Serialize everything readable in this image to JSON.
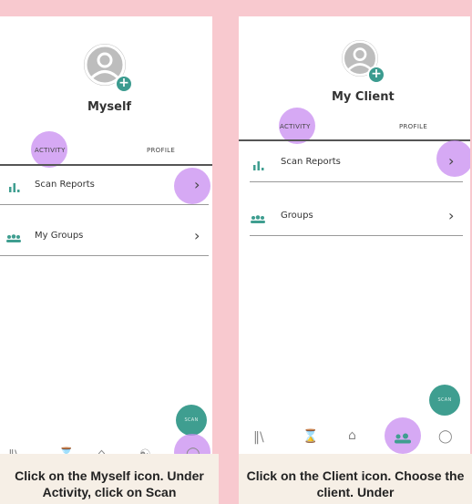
{
  "left": {
    "title": "Myself",
    "tabs": {
      "activity": "ACTIVITY",
      "profile": "PROFILE"
    },
    "rows": [
      {
        "label": "Scan Reports",
        "icon": "bar-chart-icon"
      },
      {
        "label": "My Groups",
        "icon": "groups-icon"
      }
    ],
    "scan_label": "SCAN",
    "caption": "Click on the Myself icon. Under Activity, click on Scan"
  },
  "right": {
    "title": "My Client",
    "tabs": {
      "activity": "ACTIVITY",
      "profile": "PROFILE"
    },
    "rows": [
      {
        "label": "Scan Reports",
        "icon": "bar-chart-icon"
      },
      {
        "label": "Groups",
        "icon": "groups-icon"
      }
    ],
    "scan_label": "SCAN",
    "caption": "Click on the Client icon. Choose the client. Under"
  },
  "colors": {
    "background": "#f8c9cf",
    "accent": "#3f9e90",
    "highlight": "#c88cf0"
  },
  "nav_icons": [
    "library-icon",
    "hourglass-icon",
    "home-icon",
    "clients-icon",
    "profile-icon"
  ]
}
